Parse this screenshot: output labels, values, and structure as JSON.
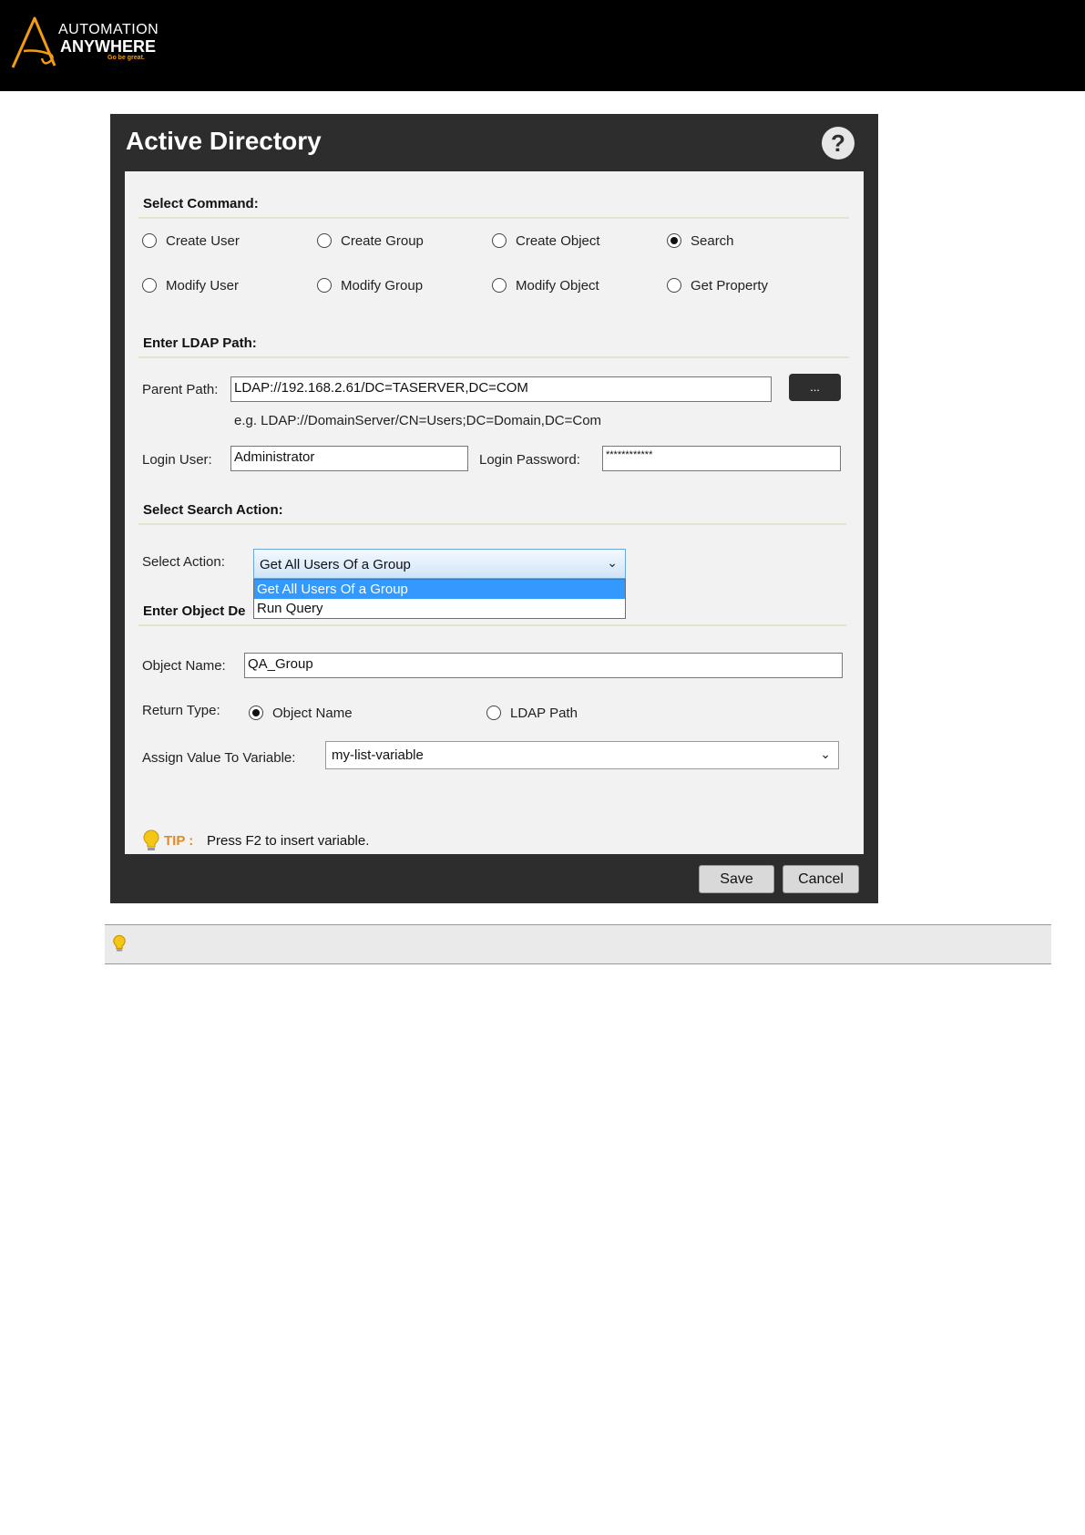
{
  "header": {
    "brand_line1": "AUTOMATION",
    "brand_line2": "ANYWHERE",
    "brand_tagline": "Go be great.",
    "brand_colors": {
      "mark": "#f39c12",
      "band": "#000000"
    }
  },
  "dialog": {
    "title": "Active Directory",
    "help_icon": "question-mark-icon",
    "help_glyph": "?"
  },
  "select_command": {
    "heading": "Select Command:",
    "options_row1": [
      {
        "label": "Create User",
        "selected": false
      },
      {
        "label": "Create Group",
        "selected": false
      },
      {
        "label": "Create Object",
        "selected": false
      },
      {
        "label": "Search",
        "selected": true
      }
    ],
    "options_row2": [
      {
        "label": "Modify User",
        "selected": false
      },
      {
        "label": "Modify Group",
        "selected": false
      },
      {
        "label": "Modify Object",
        "selected": false
      },
      {
        "label": "Get Property",
        "selected": false
      }
    ]
  },
  "ldap": {
    "heading": "Enter LDAP Path:",
    "parent_path_label": "Parent Path:",
    "parent_path_value": "LDAP://192.168.2.61/DC=TASERVER,DC=COM",
    "browse_label": "...",
    "example": "e.g. LDAP://DomainServer/CN=Users;DC=Domain,DC=Com",
    "login_user_label": "Login User:",
    "login_user_value": "Administrator",
    "login_password_label": "Login Password:",
    "login_password_value": "************"
  },
  "search_action": {
    "heading": "Select Search Action:",
    "select_label": "Select Action:",
    "selected_value": "Get All Users Of a Group",
    "options": [
      "Get All Users Of a Group",
      "Run Query"
    ]
  },
  "object_details": {
    "heading": "Enter Object De",
    "object_name_label": "Object Name:",
    "object_name_value": "QA_Group",
    "return_type_label": "Return Type:",
    "return_options": [
      {
        "label": "Object Name",
        "selected": true
      },
      {
        "label": "LDAP Path",
        "selected": false
      }
    ],
    "assign_label": "Assign Value To Variable:",
    "assign_value": "my-list-variable"
  },
  "tip": {
    "label": "TIP :",
    "text": "Press F2 to insert variable.",
    "icon": "lightbulb-icon",
    "color": "#e08a2a"
  },
  "footer": {
    "save_label": "Save",
    "cancel_label": "Cancel"
  },
  "note": {
    "icon": "lightbulb-icon"
  }
}
